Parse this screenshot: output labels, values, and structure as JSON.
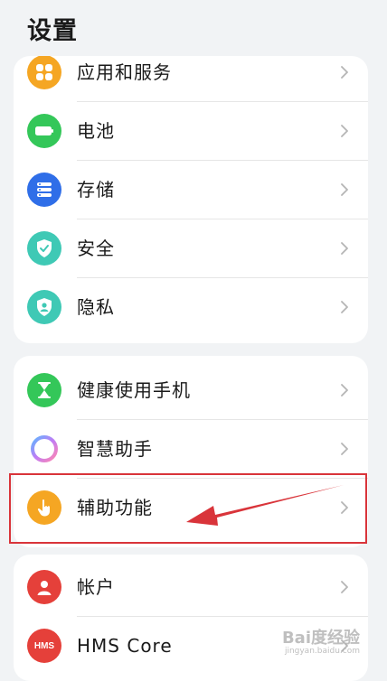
{
  "page": {
    "title": "设置"
  },
  "groups": [
    {
      "items": [
        {
          "label": "应用和服务",
          "icon": "apps-icon",
          "color": "#f5a623"
        },
        {
          "label": "电池",
          "icon": "battery-icon",
          "color": "#34c759"
        },
        {
          "label": "存储",
          "icon": "storage-icon",
          "color": "#2f6ee8"
        },
        {
          "label": "安全",
          "icon": "shield-check-icon",
          "color": "#3fc9b5"
        },
        {
          "label": "隐私",
          "icon": "privacy-shield-icon",
          "color": "#3fc9b5"
        }
      ]
    },
    {
      "items": [
        {
          "label": "健康使用手机",
          "icon": "hourglass-icon",
          "color": "#34c759"
        },
        {
          "label": "智慧助手",
          "icon": "assistant-ring-icon",
          "color": "#b07cf2"
        },
        {
          "label": "辅助功能",
          "icon": "hand-touch-icon",
          "color": "#f5a623"
        }
      ]
    },
    {
      "items": [
        {
          "label": "帐户",
          "icon": "account-icon",
          "color": "#e5403a"
        },
        {
          "label": "HMS Core",
          "icon": "hms-icon",
          "color": "#e5403a",
          "icon_text": "HMS"
        }
      ]
    }
  ],
  "annotation": {
    "highlight_color": "#d9343a"
  },
  "watermark": {
    "brand": "Bai度经验",
    "url": "jingyan.baidu.com"
  }
}
